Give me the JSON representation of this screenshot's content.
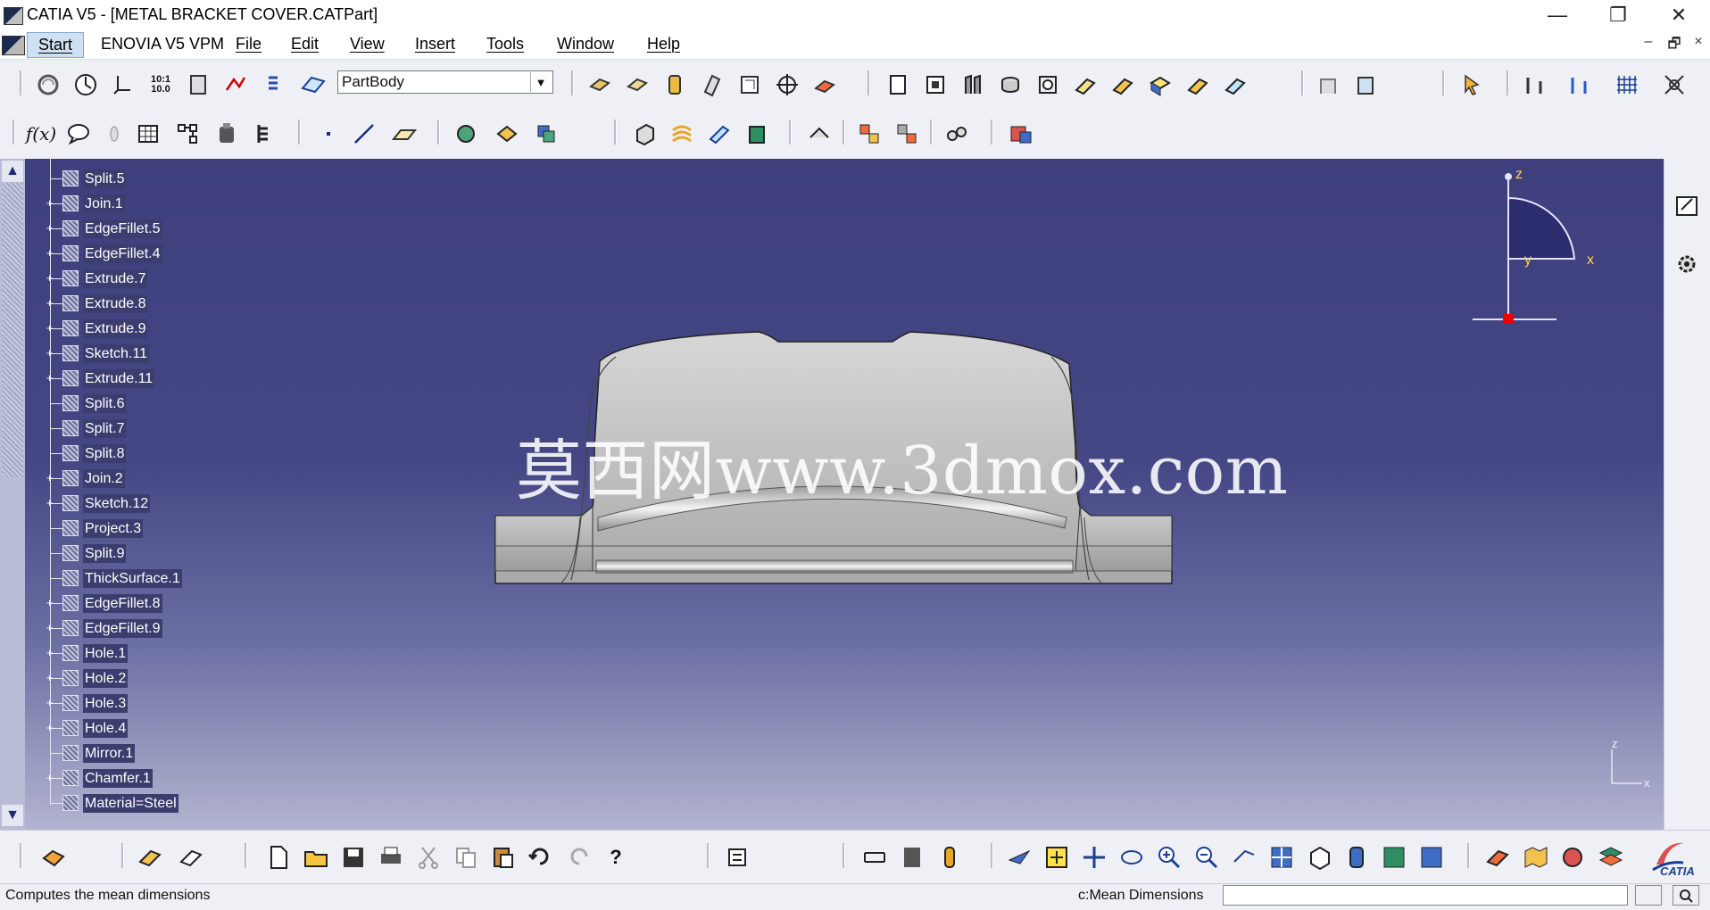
{
  "window": {
    "title": "CATIA V5 - [METAL BRACKET COVER.CATPart]",
    "minimize_glyph": "—",
    "restore_glyph": "❐",
    "close_glyph": "✕"
  },
  "menu": {
    "items": [
      "Start",
      "ENOVIA V5 VPM",
      "File",
      "Edit",
      "View",
      "Insert",
      "Tools",
      "Window",
      "Help"
    ],
    "mdi_controls": [
      "–",
      "🗗",
      "×"
    ]
  },
  "toolbar": {
    "body_select_value": "PartBody",
    "ratio_label_top": "10:1",
    "ratio_label_bottom": "10.0",
    "formula_label": "f(x)"
  },
  "tree": {
    "items": [
      {
        "label": "Split.5",
        "icon": "split-icon",
        "expandable": false,
        "selected": true
      },
      {
        "label": "Join.1",
        "icon": "join-icon",
        "expandable": true,
        "selected": true
      },
      {
        "label": "EdgeFillet.5",
        "icon": "edge-fillet-icon",
        "expandable": true,
        "selected": true
      },
      {
        "label": "EdgeFillet.4",
        "icon": "edge-fillet-icon",
        "expandable": true,
        "selected": true
      },
      {
        "label": "Extrude.7",
        "icon": "extrude-icon",
        "expandable": true,
        "selected": true
      },
      {
        "label": "Extrude.8",
        "icon": "extrude-icon",
        "expandable": true,
        "selected": true
      },
      {
        "label": "Extrude.9",
        "icon": "extrude-icon",
        "expandable": true,
        "selected": true
      },
      {
        "label": "Sketch.11",
        "icon": "sketch-icon",
        "expandable": true,
        "selected": true
      },
      {
        "label": "Extrude.11",
        "icon": "extrude-icon",
        "expandable": true,
        "selected": true
      },
      {
        "label": "Split.6",
        "icon": "split-icon",
        "expandable": false,
        "selected": true
      },
      {
        "label": "Split.7",
        "icon": "split-icon",
        "expandable": false,
        "selected": true
      },
      {
        "label": "Split.8",
        "icon": "split-icon",
        "expandable": false,
        "selected": true
      },
      {
        "label": "Join.2",
        "icon": "join-icon",
        "expandable": true,
        "selected": true
      },
      {
        "label": "Sketch.12",
        "icon": "sketch-icon",
        "expandable": true,
        "selected": true
      },
      {
        "label": "Project.3",
        "icon": "project-icon",
        "expandable": false,
        "selected": true
      },
      {
        "label": "Split.9",
        "icon": "split-icon",
        "expandable": false,
        "selected": true
      },
      {
        "label": "ThickSurface.1",
        "icon": "thick-surface-icon",
        "expandable": false,
        "selected": true
      },
      {
        "label": "EdgeFillet.8",
        "icon": "edge-fillet-icon",
        "expandable": true,
        "selected": true
      },
      {
        "label": "EdgeFillet.9",
        "icon": "edge-fillet-icon",
        "expandable": true,
        "selected": true
      },
      {
        "label": "Hole.1",
        "icon": "hole-icon",
        "expandable": true,
        "selected": true
      },
      {
        "label": "Hole.2",
        "icon": "hole-icon",
        "expandable": true,
        "selected": true
      },
      {
        "label": "Hole.3",
        "icon": "hole-icon",
        "expandable": true,
        "selected": true
      },
      {
        "label": "Hole.4",
        "icon": "hole-icon",
        "expandable": true,
        "selected": true
      },
      {
        "label": "Mirror.1",
        "icon": "mirror-icon",
        "expandable": false,
        "selected": true
      },
      {
        "label": "Chamfer.1",
        "icon": "chamfer-icon",
        "expandable": true,
        "selected": true
      },
      {
        "label": "Material=Steel",
        "icon": "material-icon",
        "expandable": false,
        "selected": true
      }
    ]
  },
  "viewport": {
    "watermark": "莫西网www.3dmox.com",
    "compass_labels": {
      "z": "z",
      "x": "x",
      "y": "y"
    },
    "axis_labels": {
      "z": "z",
      "x": "x"
    },
    "brand": "CATIA"
  },
  "status": {
    "message": "Computes the mean dimensions",
    "command": "c:Mean Dimensions",
    "command_value": ""
  },
  "colors": {
    "viewport_top": "#3e3f7c",
    "viewport_bottom": "#b3b4d0",
    "tree_selection": "#3a3d6e",
    "start_highlight": "#cfe0f3"
  }
}
